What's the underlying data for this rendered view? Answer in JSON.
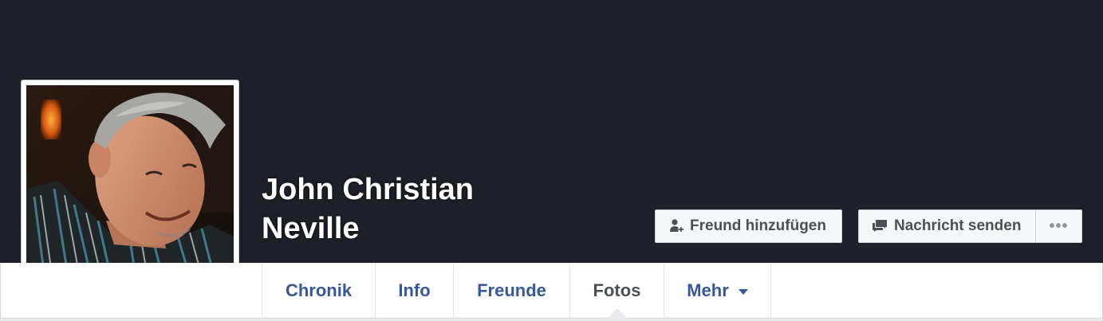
{
  "profile": {
    "name_line1": "John Christian",
    "name_line2": "Neville"
  },
  "actions": {
    "add_friend_label": "Freund hinzufügen",
    "send_message_label": "Nachricht senden",
    "more_label": "•••"
  },
  "tabs": [
    {
      "label": "Chronik",
      "active": false
    },
    {
      "label": "Info",
      "active": false
    },
    {
      "label": "Freunde",
      "active": false
    },
    {
      "label": "Fotos",
      "active": true
    },
    {
      "label": "Mehr",
      "active": false
    }
  ],
  "colors": {
    "cover": "#1d2029",
    "link": "#365899",
    "active_tab": "#4b4f56",
    "button_bg": "#f6f7f9"
  }
}
